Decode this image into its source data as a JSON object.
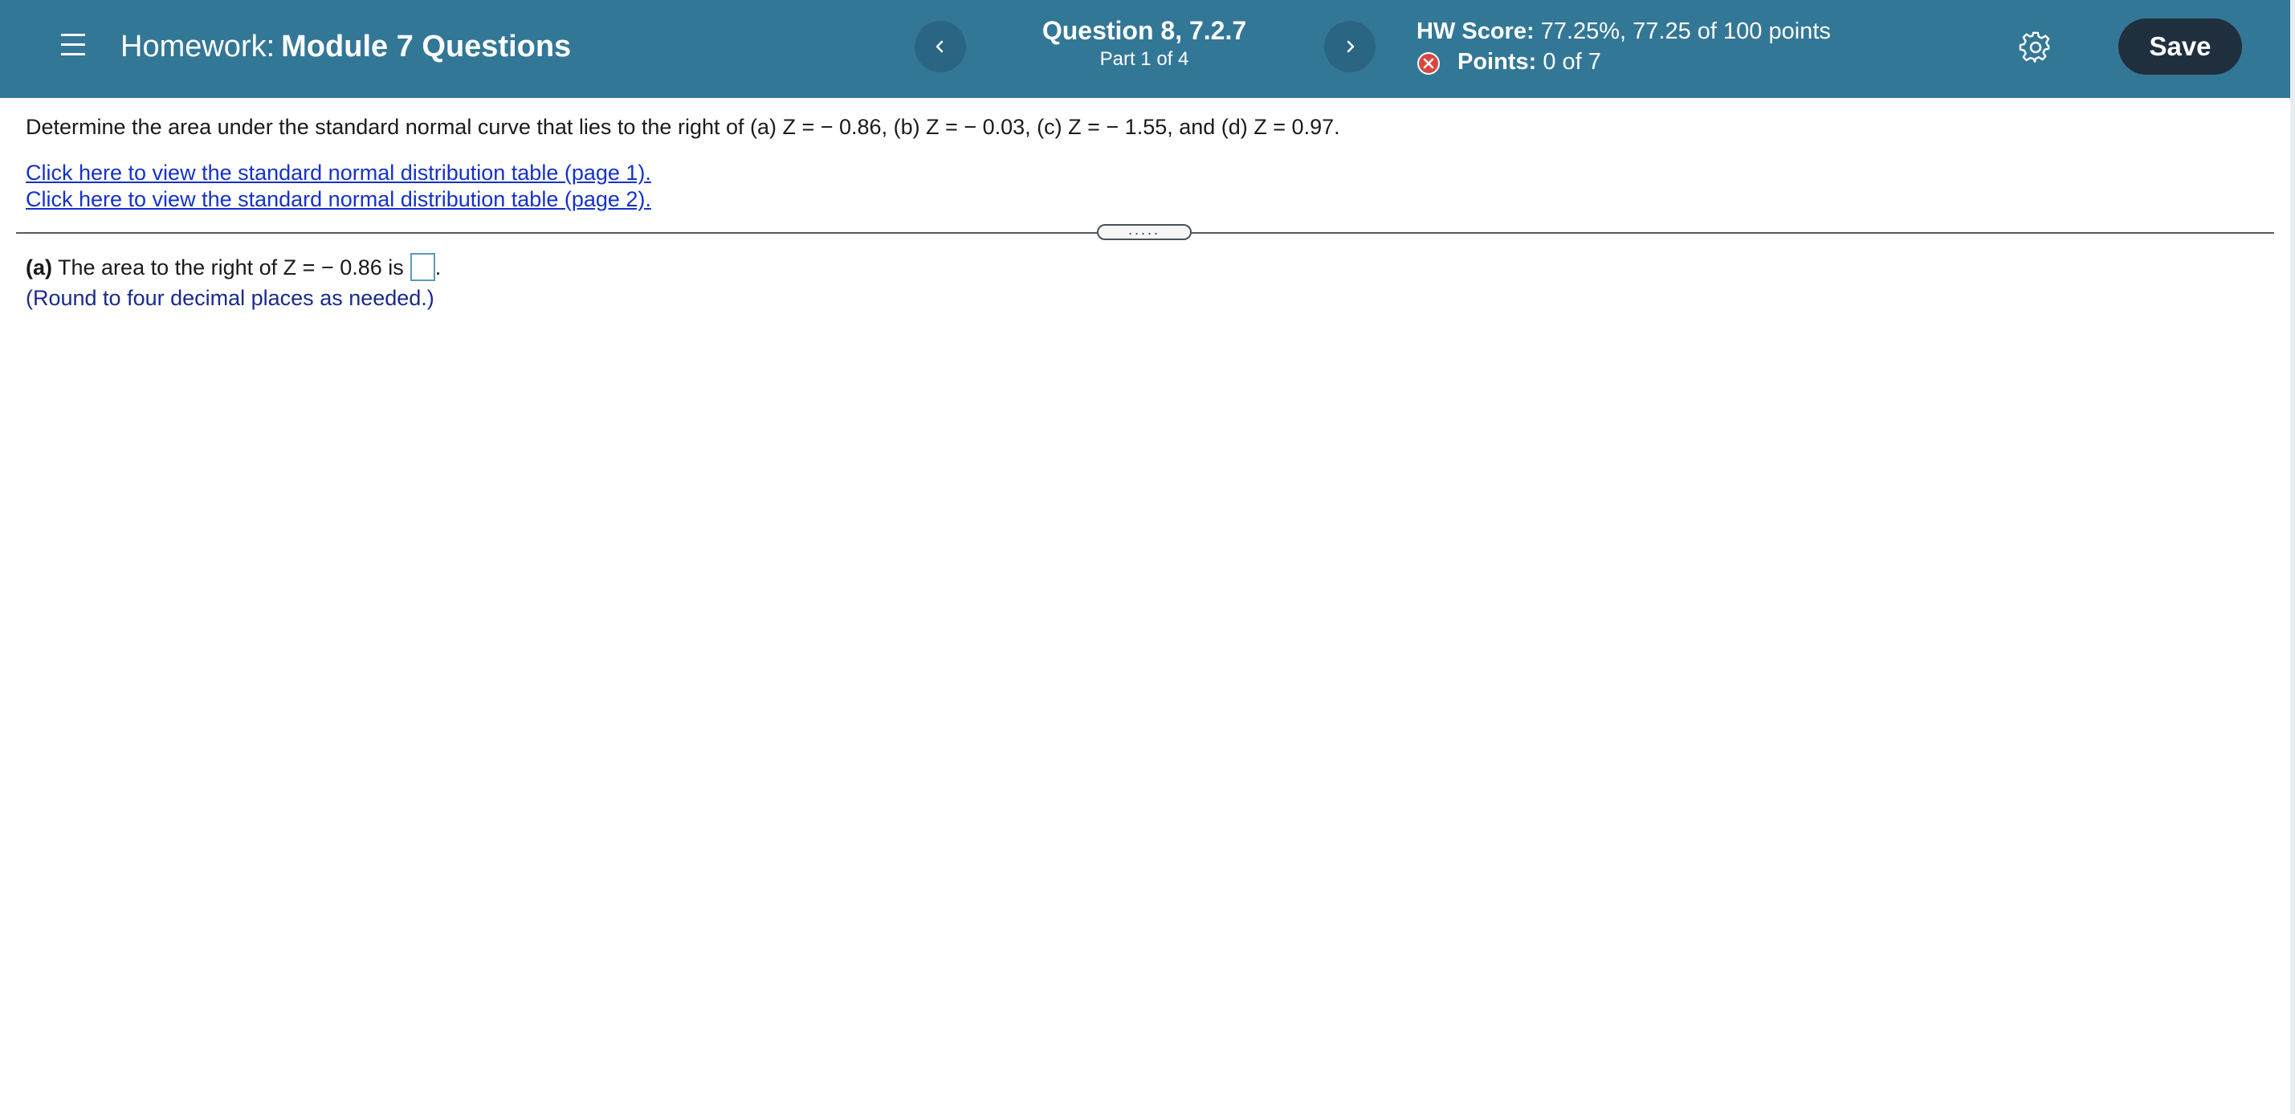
{
  "header": {
    "menu_icon": "hamburger-menu-icon",
    "hw_label": "Homework:",
    "hw_name": "Module 7 Questions",
    "question_title": "Question 8, 7.2.7",
    "question_part": "Part 1 of 4",
    "prev_icon": "chevron-left-icon",
    "next_icon": "chevron-right-icon",
    "hw_score_label": "HW Score:",
    "hw_score_value": "77.25%, 77.25 of 100 points",
    "points_icon": "x-circle-icon",
    "points_label": "Points:",
    "points_value": "0 of 7",
    "settings_icon": "gear-icon",
    "save_label": "Save",
    "bar_color": "#337797",
    "save_color": "#1f2f3e",
    "incorrect_color": "#d8473f"
  },
  "question": {
    "prompt": "Determine the area under the standard normal curve that lies to the right of (a) Z = − 0.86, (b) Z = − 0.03, (c) Z = − 1.55, and (d) Z = 0.97.",
    "link_1": "Click here to view the standard normal distribution table (page 1).",
    "link_2": "Click here to view the standard normal distribution table (page 2).",
    "grip_label": "....."
  },
  "answer": {
    "part_label": "(a)",
    "text": "The area to the right of Z = − 0.86 is",
    "value": "",
    "suffix": ".",
    "hint": "(Round to four decimal places as needed.)"
  }
}
